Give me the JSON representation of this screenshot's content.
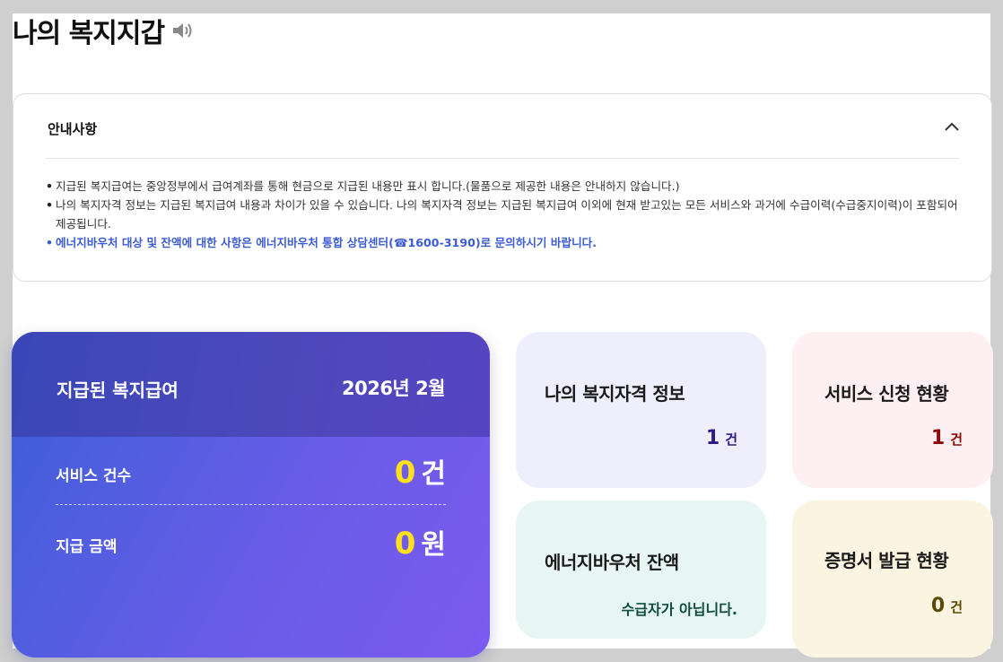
{
  "page": {
    "title": "나의 복지지갑",
    "speaker_icon": "speaker-icon"
  },
  "notice": {
    "heading": "안내사항",
    "toggle_icon": "chevron-up-icon",
    "items": [
      "지급된 복지급여는 중앙정부에서 급여계좌를 통해 현금으로 지급된 내용만 표시 합니다.(물품으로 제공한 내용은 안내하지 않습니다.)",
      "나의 복지자격 정보는 지급된 복지급여 내용과 차이가 있을 수 있습니다. 나의 복지자격 정보는 지급된 복지급여 이외에 현재 받고있는 모든 서비스와 과거에 수급이력(수급중지이력)이 포함되어 제공됩니다.",
      "에너지바우처 대상 및 잔액에 대한 사항은 에너지바우처 통합 상담센터(☎1600-3190)로 문의하시기 바랍니다."
    ]
  },
  "welfare": {
    "label": "지급된 복지급여",
    "date": "2026년  2월",
    "service_count_label": "서비스 건수",
    "service_count_value": "0",
    "service_count_unit": "건",
    "amount_label": "지급 금액",
    "amount_value": "0",
    "amount_unit": "원"
  },
  "cards": {
    "eligibility": {
      "title": "나의 복지자격 정보",
      "value": "1",
      "unit": "건"
    },
    "application": {
      "title": "서비스 신청 현황",
      "value": "1",
      "unit": "건"
    },
    "voucher": {
      "title": "에너지바우처 잔액",
      "status": "수급자가 아닙니다."
    },
    "certificate": {
      "title": "증명서 발급 현황",
      "value": "0",
      "unit": "건"
    }
  },
  "colors": {
    "accent_yellow": "#ffe01a",
    "eligibility_value": "#2a1a8c",
    "application_value": "#8b0a0a",
    "voucher_status": "#0e4d3a",
    "certificate_value": "#5b4a06",
    "notice_highlight": "#3b5bd4"
  }
}
